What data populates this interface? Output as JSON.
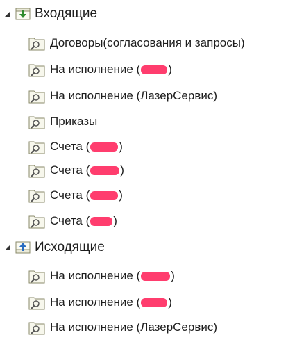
{
  "tree": {
    "groups": [
      {
        "label": "Входящие",
        "icon": "inbox-folder-icon",
        "expanded": true,
        "items": [
          {
            "label": "Договоры(согласования и запросы)",
            "redacted": false
          },
          {
            "label_prefix": "На исполнение (",
            "label_suffix": ")",
            "redacted": true
          },
          {
            "label": "На исполнение (ЛазерСервис)",
            "redacted": false
          },
          {
            "label": "Приказы",
            "redacted": false
          },
          {
            "label_prefix": "Счета (",
            "label_suffix": ")",
            "redacted": true
          },
          {
            "label_prefix": "Счета (",
            "label_suffix": ")",
            "redacted": true
          },
          {
            "label_prefix": "Счета (",
            "label_suffix": ")",
            "redacted": true
          },
          {
            "label_prefix": "Счета (",
            "label_suffix": ")",
            "redacted": true
          }
        ]
      },
      {
        "label": "Исходящие",
        "icon": "outbox-folder-icon",
        "expanded": true,
        "items": [
          {
            "label_prefix": "На исполнение (",
            "label_suffix": ")",
            "redacted": true
          },
          {
            "label_prefix": "На исполнение (",
            "label_suffix": ")",
            "redacted": true
          },
          {
            "label": "На исполнение (ЛазерСервис)",
            "redacted": false
          }
        ]
      }
    ]
  },
  "colors": {
    "text": "#1e1e1e",
    "redaction": "#ff3d6e",
    "inbox_arrow": "#2e8b2e",
    "outbox_arrow": "#2a6cc0",
    "folder_outline": "#8a8a6a"
  }
}
